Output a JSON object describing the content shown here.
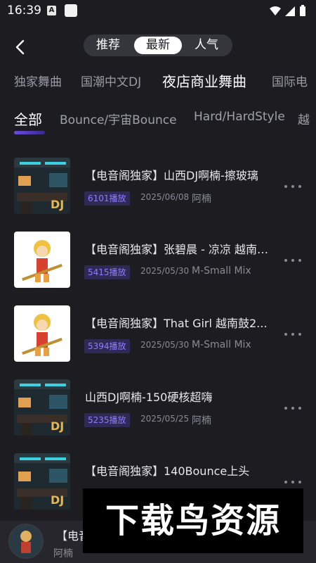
{
  "status": {
    "time": "16:39",
    "notif_a": "A"
  },
  "header": {
    "segments": [
      {
        "label": "推荐",
        "active": false
      },
      {
        "label": "最新",
        "active": true
      },
      {
        "label": "人气",
        "active": false
      }
    ]
  },
  "categories": [
    "独家舞曲",
    "国潮中文DJ",
    "夜店商业舞曲",
    "国际电"
  ],
  "subcategories": [
    "全部",
    "Bounce/宇宙Bounce",
    "Hard/HardStyle",
    "越"
  ],
  "tracks": [
    {
      "title": "【电音阁独家】山西DJ啊楠-擦玻璃",
      "plays": "6101播放",
      "date": "2025/06/08",
      "artist": "阿楠",
      "cover": "studio"
    },
    {
      "title": "【电音阁独家】张碧晨 - 凉凉 越南鼓...",
      "plays": "5415播放",
      "date": "2025/05/30",
      "artist": "M-Small Mix",
      "cover": "monkey"
    },
    {
      "title": "【电音阁独家】That Girl 越南鼓2...",
      "plays": "5394播放",
      "date": "2025/05/30",
      "artist": "M-Small Mix",
      "cover": "monkey"
    },
    {
      "title": "山西DJ啊楠-150硬核超嗨",
      "plays": "5235播放",
      "date": "2025/05/25",
      "artist": "阿楠",
      "cover": "studio"
    },
    {
      "title": "【电音阁独家】140Bounce上头",
      "plays": "",
      "date": "",
      "artist": "",
      "cover": "studio"
    }
  ],
  "player": {
    "title": "【电音",
    "artist": "阿楠"
  },
  "watermark": "下载鸟资源",
  "colors": {
    "background": "#1c1c21",
    "accent": "#8f7bff",
    "play_badge_bg": "#2d2a55"
  }
}
